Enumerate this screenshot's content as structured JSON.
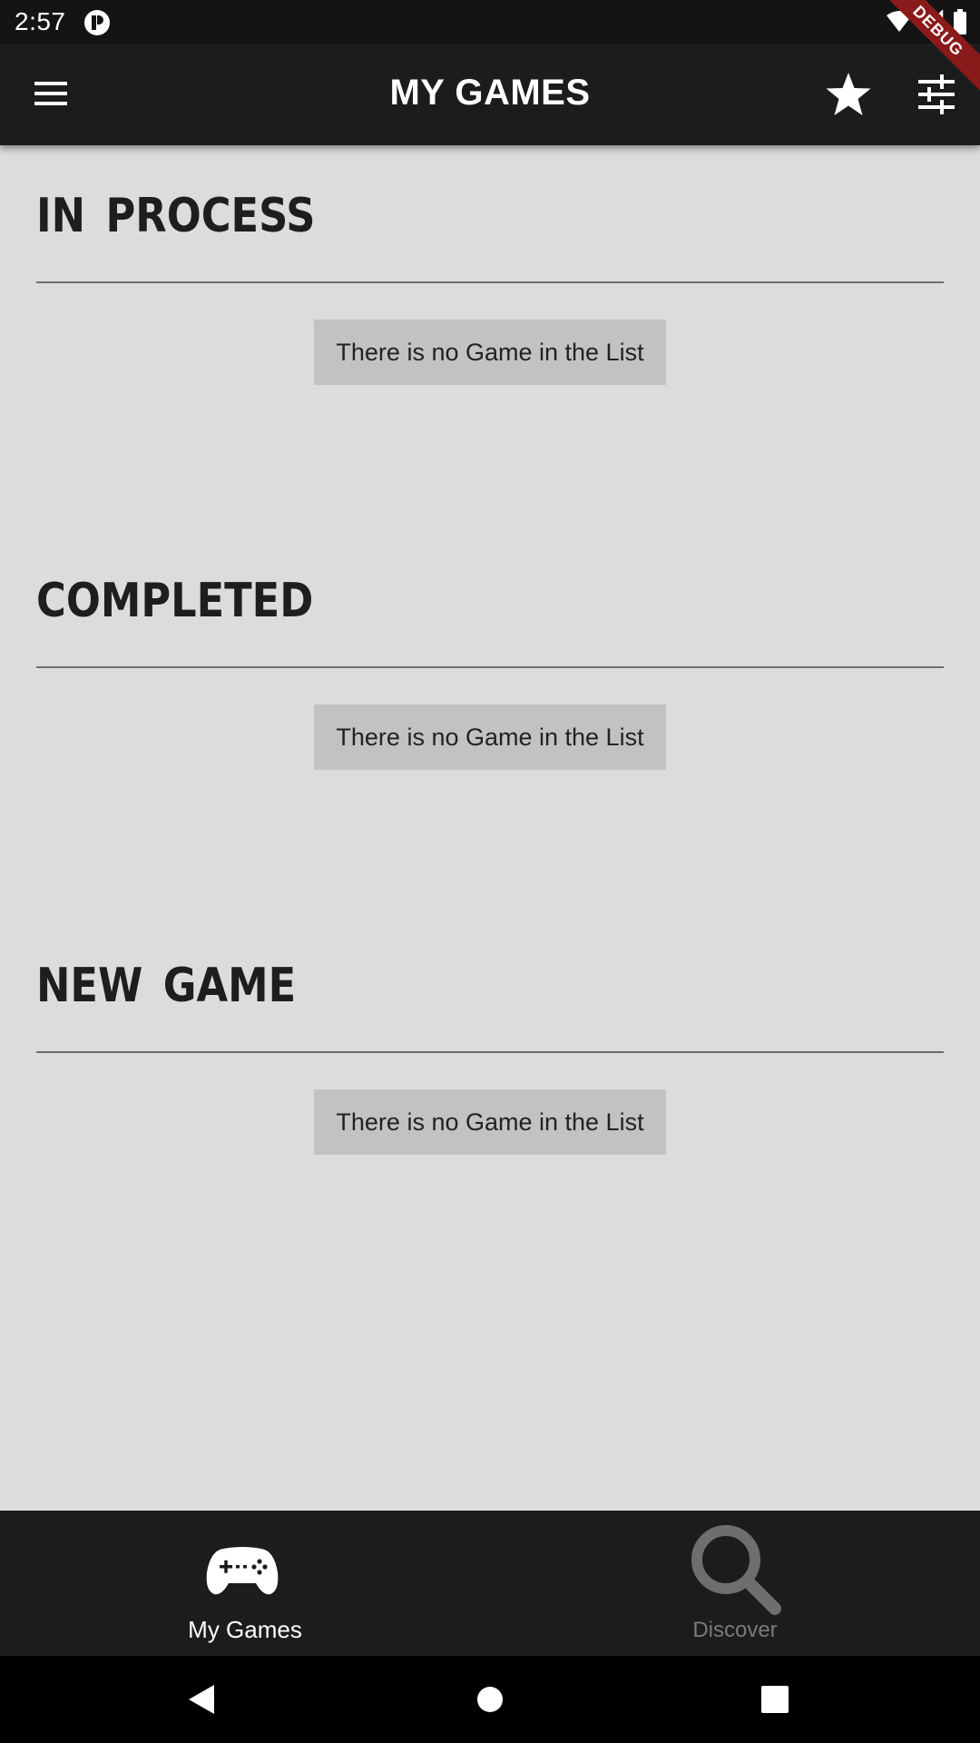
{
  "status_bar": {
    "time": "2:57",
    "icons": [
      "notification-icon",
      "wifi-icon",
      "signal-icon",
      "battery-icon"
    ]
  },
  "debug_banner": "DEBUG",
  "app_bar": {
    "title": "MY GAMES",
    "left_icon": "menu-icon",
    "right_icons": [
      "star-icon",
      "filter-icon"
    ]
  },
  "sections": [
    {
      "title": "IN  PROCESS",
      "empty_message": "There is no Game in the List"
    },
    {
      "title": "COMPLETED",
      "empty_message": "There is no Game in the List"
    },
    {
      "title": "NEW  GAME",
      "empty_message": "There is no Game in the List"
    }
  ],
  "bottom_nav": {
    "items": [
      {
        "label": "My Games",
        "icon": "gamepad-icon",
        "active": true
      },
      {
        "label": "Discover",
        "icon": "search-icon",
        "active": false
      }
    ]
  },
  "system_nav": [
    "back-icon",
    "home-icon",
    "recents-icon"
  ],
  "colors": {
    "background": "#dcdcdc",
    "app_bar": "#1c1c1c",
    "empty_box": "#c2c2c2",
    "debug_ribbon": "#8b1a1a",
    "inactive_nav": "#7a7a7a"
  }
}
